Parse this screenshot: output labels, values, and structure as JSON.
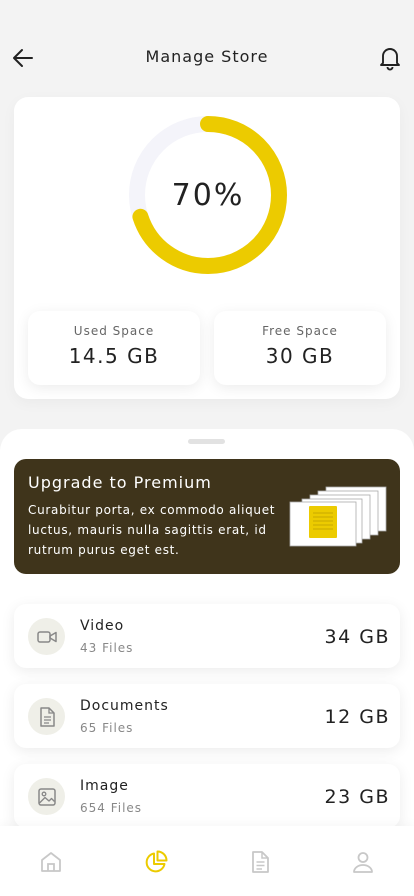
{
  "header": {
    "title": "Manage Store",
    "back_icon": "arrow-left-icon",
    "notification_icon": "bell-icon"
  },
  "storage": {
    "percent_label": "70%",
    "percent_used": 0.7,
    "used_label": "Used Space",
    "used_value": "14.5 GB",
    "free_label": "Free Space",
    "free_value": "30 GB"
  },
  "promo": {
    "title": "Upgrade to Premium",
    "text": "Curabitur porta, ex commodo aliquet luctus, mauris nulla sagittis erat, id rutrum purus eget est."
  },
  "files": [
    {
      "name": "Video",
      "count": "43 Files",
      "size": "34 GB",
      "icon": "video-icon"
    },
    {
      "name": "Documents",
      "count": "65 Files",
      "size": "12 GB",
      "icon": "document-icon"
    },
    {
      "name": "Image",
      "count": "654 Files",
      "size": "23 GB",
      "icon": "image-icon"
    }
  ],
  "nav": [
    {
      "icon": "home-icon",
      "active": false
    },
    {
      "icon": "pie-chart-icon",
      "active": true
    },
    {
      "icon": "file-icon",
      "active": false
    },
    {
      "icon": "user-icon",
      "active": false
    }
  ],
  "colors": {
    "accent": "#eccb00",
    "ring_track": "#f4f4fa",
    "promo_bg": "#3f341b",
    "icon_bg": "#efefe8",
    "nav_inactive": "#c8c8c8"
  }
}
